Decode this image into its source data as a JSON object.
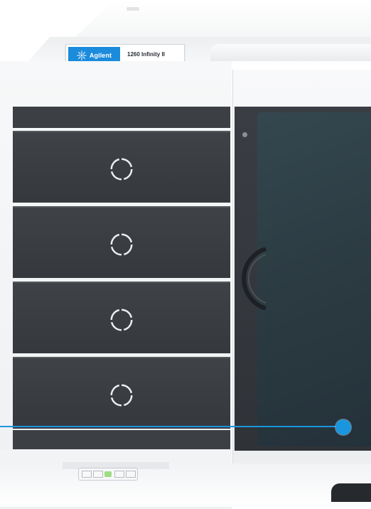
{
  "label": {
    "brand": "Agilent",
    "model": "1260 Infinity II"
  },
  "drawers": [
    {
      "id": "drawer-1"
    },
    {
      "id": "drawer-2"
    },
    {
      "id": "drawer-3"
    },
    {
      "id": "drawer-4"
    }
  ],
  "colors": {
    "accent": "#1a96de",
    "logo_bg": "#1b8bdc",
    "drawer": "#3c3f44",
    "housing": "#f4f5f6",
    "power_led": "#9ddc83"
  },
  "icons": {
    "logo": "agilent-spark-icon",
    "drawer_handle": "ring-handle-icon",
    "power": "power-switch-icon"
  }
}
